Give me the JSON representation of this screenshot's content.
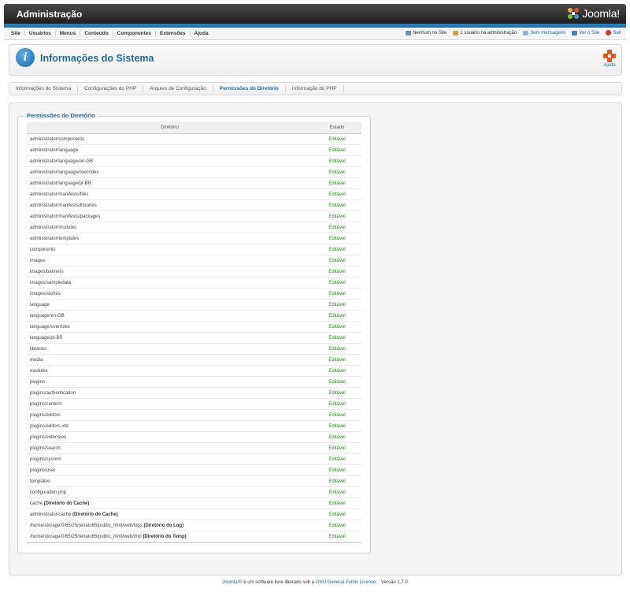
{
  "header": {
    "title": "Administração",
    "logo_text": "Joomla!"
  },
  "menu": {
    "items": [
      "Site",
      "Usuários",
      "Menus",
      "Conteúdo",
      "Componentes",
      "Extensões",
      "Ajuda"
    ]
  },
  "status": {
    "visitors": "Nenhum no Site",
    "admins": "1 usuário na administração",
    "messages": "Sem mensagens",
    "view_site": "Ver o Site",
    "logout": "Sair"
  },
  "toolbar": {
    "page_title": "Informações do Sistema",
    "help_label": "Ajuda"
  },
  "tabs": [
    "Informações do Sistema",
    "Configurações do PHP",
    "Arquivo de Configuração",
    "Permissões do Diretório",
    "Informação do PHP"
  ],
  "active_tab": "Permissões do Diretório",
  "panel": {
    "legend": "Permissões do Diretório",
    "columns": {
      "directory": "Diretório",
      "status": "Estado"
    },
    "rows": [
      {
        "path": "administrator/components",
        "note": "",
        "status": "Editável"
      },
      {
        "path": "administrator/language",
        "note": "",
        "status": "Editável"
      },
      {
        "path": "administrator/language/en-GB",
        "note": "",
        "status": "Editável"
      },
      {
        "path": "administrator/language/overrides",
        "note": "",
        "status": "Editável"
      },
      {
        "path": "administrator/language/pt-BR",
        "note": "",
        "status": "Editável"
      },
      {
        "path": "administrator/manifests/files",
        "note": "",
        "status": "Editável"
      },
      {
        "path": "administrator/manifests/libraries",
        "note": "",
        "status": "Editável"
      },
      {
        "path": "administrator/manifests/packages",
        "note": "",
        "status": "Editável"
      },
      {
        "path": "administrator/modules",
        "note": "",
        "status": "Editável"
      },
      {
        "path": "administrator/templates",
        "note": "",
        "status": "Editável"
      },
      {
        "path": "components",
        "note": "",
        "status": "Editável"
      },
      {
        "path": "images",
        "note": "",
        "status": "Editável"
      },
      {
        "path": "images/banners",
        "note": "",
        "status": "Editável"
      },
      {
        "path": "images/sampledata",
        "note": "",
        "status": "Editável"
      },
      {
        "path": "images/stories",
        "note": "",
        "status": "Editável"
      },
      {
        "path": "language",
        "note": "",
        "status": "Editável"
      },
      {
        "path": "language/en-GB",
        "note": "",
        "status": "Editável"
      },
      {
        "path": "language/overrides",
        "note": "",
        "status": "Editável"
      },
      {
        "path": "language/pt-BR",
        "note": "",
        "status": "Editável"
      },
      {
        "path": "libraries",
        "note": "",
        "status": "Editável"
      },
      {
        "path": "media",
        "note": "",
        "status": "Editável"
      },
      {
        "path": "modules",
        "note": "",
        "status": "Editável"
      },
      {
        "path": "plugins",
        "note": "",
        "status": "Editável"
      },
      {
        "path": "plugins/authentication",
        "note": "",
        "status": "Editável"
      },
      {
        "path": "plugins/content",
        "note": "",
        "status": "Editável"
      },
      {
        "path": "plugins/editors",
        "note": "",
        "status": "Editável"
      },
      {
        "path": "plugins/editors-xtd",
        "note": "",
        "status": "Editável"
      },
      {
        "path": "plugins/extension",
        "note": "",
        "status": "Editável"
      },
      {
        "path": "plugins/search",
        "note": "",
        "status": "Editável"
      },
      {
        "path": "plugins/system",
        "note": "",
        "status": "Editável"
      },
      {
        "path": "plugins/user",
        "note": "",
        "status": "Editável"
      },
      {
        "path": "templates",
        "note": "",
        "status": "Editável"
      },
      {
        "path": "configuration.php",
        "note": "",
        "status": "Editável"
      },
      {
        "path": "cache",
        "note": "(Diretório do Cache)",
        "status": "Editável"
      },
      {
        "path": "administrator/cache",
        "note": "(Diretório do Cache)",
        "status": "Editável"
      },
      {
        "path": "/home/storage/0/65/25/renato65/public_html/web/logs",
        "note": "(Diretório do Log)",
        "status": "Editável"
      },
      {
        "path": "/home/storage/0/65/25/renato65/public_html/web/tmp",
        "note": "(Diretório do Temp)",
        "status": "Editável"
      }
    ]
  },
  "footer": {
    "link_joomla": "Joomla!®",
    "text": " é um software livre liberado sob a ",
    "link_license": "GNU General Public License.",
    "version": "Versão 1.7.0"
  },
  "colors": {
    "accent": "#1f6aa6",
    "status_ok": "#2a8a1e",
    "header_dark": "#1e1e1e",
    "strip": "#2c86c8"
  }
}
